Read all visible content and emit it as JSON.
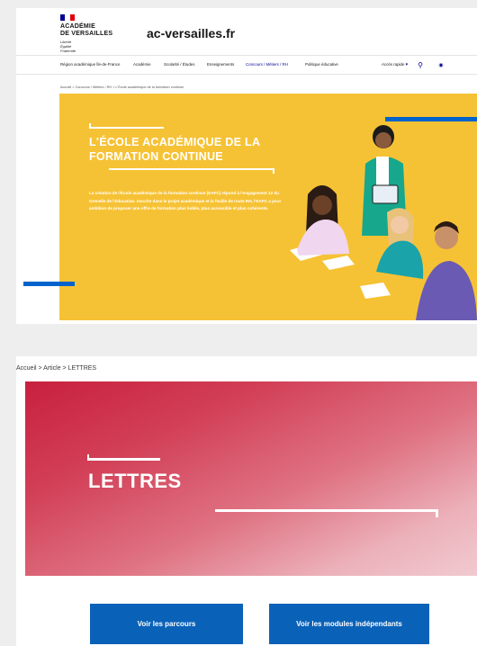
{
  "colors": {
    "brand_blue": "#000091",
    "accent_blue": "#0063cb",
    "hero_yellow": "#f6c235",
    "hero_red": "#c8203f",
    "button_blue": "#0a62b8"
  },
  "header": {
    "logo_line1": "ACADÉMIE",
    "logo_line2": "DE VERSAILLES",
    "motto": [
      "Liberté",
      "Égalité",
      "Fraternité"
    ],
    "site_name": "ac-versailles.fr"
  },
  "nav": {
    "items": [
      {
        "label": "Région académique Île-de-France"
      },
      {
        "label": "Académie"
      },
      {
        "label": "Scolarité / Études"
      },
      {
        "label": "Enseignements"
      },
      {
        "label": "Concours / Métiers / RH"
      },
      {
        "label": "Politique éducative"
      }
    ],
    "quick_access": "Accès rapide",
    "icons": [
      "chevron-down-icon",
      "search-icon",
      "eye-icon"
    ]
  },
  "top_page": {
    "breadcrumb": "Accueil  >  Concours / Métiers / RH  >  L'École académique de la formation continue",
    "hero_title": "L'ÉCOLE ACADÉMIQUE DE LA FORMATION CONTINUE",
    "hero_text": "La création de l'École académique de la formation continue (EAFC) répond à l'engagement 12 du Grenelle de l'éducation. Inscrite dans le projet académique et la feuille de route RH, l'EAFC a pour ambition de proposer une offre de formation plus lisible, plus accessible et plus cohérente."
  },
  "bottom_page": {
    "breadcrumb": "Accueil  >  Article  >  LETTRES",
    "hero_title": "LETTRES",
    "button_parcours": "Voir les parcours",
    "button_modules": "Voir les modules indépendants"
  }
}
